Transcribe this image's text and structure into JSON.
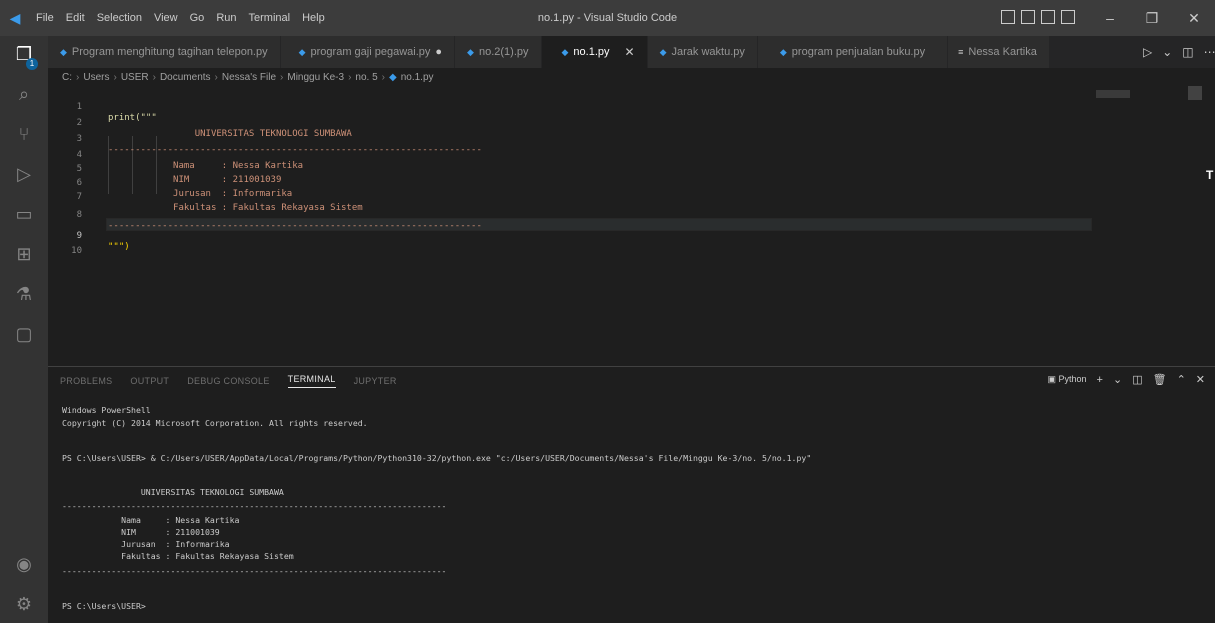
{
  "titlebar": {
    "menu": [
      "File",
      "Edit",
      "Selection",
      "View",
      "Go",
      "Run",
      "Terminal",
      "Help"
    ],
    "title": "no.1.py - Visual Studio Code"
  },
  "activity": {
    "badge": "1"
  },
  "tabs": [
    {
      "label": "Program menghitung tagihan telepon.py",
      "active": false,
      "dirty": false
    },
    {
      "label": "program gaji pegawai.py",
      "active": false,
      "dirty": true
    },
    {
      "label": "no.2(1).py",
      "active": false,
      "dirty": false
    },
    {
      "label": "no.1.py",
      "active": true,
      "dirty": false
    },
    {
      "label": "Jarak waktu.py",
      "active": false,
      "dirty": false
    },
    {
      "label": "program penjualan buku.py",
      "active": false,
      "dirty": false
    },
    {
      "label": "Nessa Kartika",
      "active": false,
      "dirty": false
    }
  ],
  "breadcrumb": [
    "C:",
    "Users",
    "USER",
    "Documents",
    "Nessa's File",
    "Minggu Ke-3",
    "no. 5",
    "no.1.py"
  ],
  "editor": {
    "lines": [
      {
        "n": "1",
        "text": "print(\"\"\""
      },
      {
        "n": "2",
        "text": "                UNIVERSITAS TEKNOLOGI SUMBAWA"
      },
      {
        "n": "3",
        "text": "---------------------------------------------------------------------"
      },
      {
        "n": "4",
        "text": "            Nama     : Nessa Kartika"
      },
      {
        "n": "5",
        "text": "            NIM      : 211001039"
      },
      {
        "n": "6",
        "text": "            Jurusan  : Informarika"
      },
      {
        "n": "7",
        "text": "            Fakultas : Fakultas Rekayasa Sistem"
      },
      {
        "n": "8",
        "text": "---------------------------------------------------------------------"
      },
      {
        "n": "9",
        "text": "\"\"\")"
      },
      {
        "n": "10",
        "text": ""
      }
    ]
  },
  "panel": {
    "tabs": [
      "PROBLEMS",
      "OUTPUT",
      "DEBUG CONSOLE",
      "TERMINAL",
      "JUPYTER"
    ],
    "active_tab": "TERMINAL",
    "shell_label": "Python"
  },
  "terminal": {
    "lines": [
      "Windows PowerShell",
      "Copyright (C) 2014 Microsoft Corporation. All rights reserved.",
      "",
      "PS C:\\Users\\USER> & C:/Users/USER/AppData/Local/Programs/Python/Python310-32/python.exe \"c:/Users/USER/Documents/Nessa's File/Minggu Ke-3/no. 5/no.1.py\"",
      "",
      "                UNIVERSITAS TEKNOLOGI SUMBAWA",
      "------------------------------------------------------------------------------",
      "            Nama     : Nessa Kartika",
      "            NIM      : 211001039",
      "            Jurusan  : Informarika",
      "            Fakultas : Fakultas Rekayasa Sistem",
      "------------------------------------------------------------------------------",
      "",
      "PS C:\\Users\\USER>"
    ]
  }
}
